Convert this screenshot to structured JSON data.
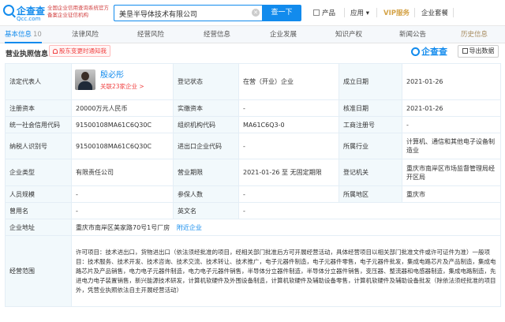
{
  "logo": {
    "name": "企查查",
    "domain": "Qcc.com"
  },
  "slogan": "全国企业信用查询系统官方备案企业征信机构",
  "search": {
    "value": "美垦半导体技术有限公司",
    "button": "查一下"
  },
  "nav": {
    "product": "产品",
    "app": "应用",
    "vip": "VIP服务",
    "kit": "企业套餐"
  },
  "tabs": [
    {
      "label": "基本信息",
      "count": "10"
    },
    {
      "label": "法律风险"
    },
    {
      "label": "经营风险"
    },
    {
      "label": "经营信息"
    },
    {
      "label": "企业发展"
    },
    {
      "label": "知识产权"
    },
    {
      "label": "新闻公告"
    },
    {
      "label": "历史信息"
    }
  ],
  "section": {
    "title": "营业执照信息",
    "notify": "股东变更时通知我",
    "watermark": "企查查",
    "export": "导出数据"
  },
  "table": {
    "legal_rep_label": "法定代表人",
    "legal_rep_name": "殷必彤",
    "legal_rep_rel": "关联23家企业 >",
    "status_label": "登记状态",
    "status": "在营（开业）企业",
    "founded_label": "成立日期",
    "founded": "2021-01-26",
    "reg_cap_label": "注册资本",
    "reg_cap": "20000万元人民币",
    "paid_cap_label": "实缴资本",
    "paid_cap": "-",
    "approved_label": "核准日期",
    "approved": "2021-01-26",
    "credit_code_label": "统一社会信用代码",
    "credit_code": "91500108MA61C6Q30C",
    "org_code_label": "组织机构代码",
    "org_code": "MA61C6Q3-0",
    "biz_reg_label": "工商注册号",
    "biz_reg": "-",
    "taxpayer_label": "纳税人识别号",
    "taxpayer": "91500108MA61C6Q30C",
    "imp_exp_label": "进出口企业代码",
    "imp_exp": "-",
    "industry_label": "所属行业",
    "industry": "计算机、通信和其他电子设备制造业",
    "type_label": "企业类型",
    "type": "有限责任公司",
    "term_label": "营业期限",
    "term": "2021-01-26 至 无固定期限",
    "authority_label": "登记机关",
    "authority": "重庆市南岸区市场监督管理局经开区局",
    "staff_label": "人员规模",
    "staff": "-",
    "insured_label": "参保人数",
    "insured": "-",
    "region_label": "所属地区",
    "region": "重庆市",
    "former_label": "曾用名",
    "former": "-",
    "english_label": "英文名",
    "english": "-",
    "address_label": "企业地址",
    "address": "重庆市南岸区美家路70号1号厂房",
    "address_link": "附近企业",
    "scope_label": "经营范围",
    "scope": "许可项目：技术进出口，货物进出口（依法须经批准的项目，经相关部门批准后方可开展经营活动，具体经营项目以相关部门批准文件或许可证件为准）一般项目：技术服务、技术开发、技术咨询、技术交流、技术转让、技术推广，电子元器件制造，电子元器件零售，电子元器件批发，集成电路芯片及产品制造，集成电路芯片及产品销售，电力电子元器件制造，电力电子元器件销售，半导体分立器件制造，半导体分立器件销售，变压器、整流器和电感器制造，集成电路制造，先进电力电子装置销售，新兴能源技术研发，计算机软硬件及外围设备制造，计算机软硬件及辅助设备零售，计算机软硬件及辅助设备批发（除依法须经批准的项目外，凭营业执照依法自主开展经营活动）"
  },
  "colors": {
    "accent": "#128bed",
    "danger": "#f04040",
    "label_bg": "#f2f9fc"
  }
}
